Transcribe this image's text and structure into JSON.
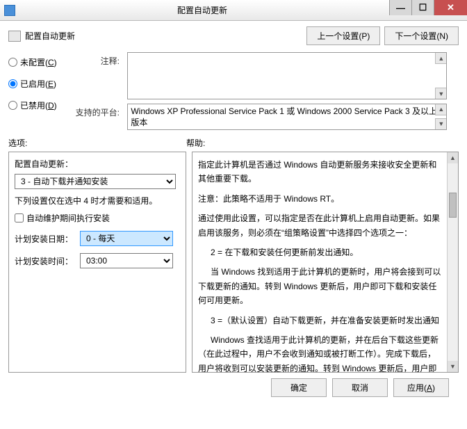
{
  "window": {
    "title": "配置自动更新",
    "min": "—",
    "max": "☐",
    "close": "✕"
  },
  "header": {
    "title": "配置自动更新",
    "prev": "上一个设置(P)",
    "next": "下一个设置(N)"
  },
  "radios": {
    "not_configured": "未配置(C)",
    "enabled": "已启用(E)",
    "disabled": "已禁用(D)"
  },
  "labels": {
    "comment": "注释:",
    "supported": "支持的平台:",
    "options": "选项:",
    "help": "帮助:"
  },
  "supported_text": "Windows XP Professional Service Pack 1 或 Windows 2000 Service Pack 3 及以上版本",
  "options": {
    "section_label": "配置自动更新：",
    "update_mode": "3 - 自动下载并通知安装",
    "note": "下列设置仅在选中 4 时才需要和适用。",
    "checkbox_label": "自动维护期间执行安装",
    "day_label": "计划安装日期：",
    "day_value": "0 - 每天",
    "time_label": "计划安装时间：",
    "time_value": "03:00"
  },
  "help": {
    "p1": "指定此计算机是否通过 Windows 自动更新服务来接收安全更新和其他重要下载。",
    "p2": "注意：此策略不适用于 Windows RT。",
    "p3": "通过使用此设置，可以指定是否在此计算机上启用自动更新。如果启用该服务，则必须在“组策略设置”中选择四个选项之一：",
    "p4": "2 = 在下载和安装任何更新前发出通知。",
    "p5": "当 Windows 找到适用于此计算机的更新时，用户将会接到可以下载更新的通知。转到 Windows 更新后，用户即可下载和安装任何可用更新。",
    "p6": "3 =（默认设置）自动下载更新，并在准备安装更新时发出通知",
    "p7": "Windows 查找适用于此计算机的更新，并在后台下载这些更新（在此过程中，用户不会收到通知或被打断工作）。完成下载后，用户将收到可以安装更新的通知。转到 Windows 更新后，用户即可安装更新。"
  },
  "footer": {
    "ok": "确定",
    "cancel": "取消",
    "apply": "应用(A)"
  }
}
